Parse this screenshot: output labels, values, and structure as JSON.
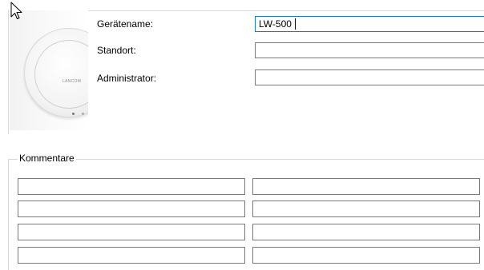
{
  "device": {
    "name_label": "Gerätename:",
    "name_value": "LW-500",
    "location_label": "Standort:",
    "location_value": "",
    "admin_label": "Administrator:",
    "admin_value": "",
    "logo_text": "LANCOM"
  },
  "comments": {
    "legend": "Kommentare",
    "fields": [
      "",
      "",
      "",
      "",
      "",
      "",
      "",
      ""
    ]
  }
}
